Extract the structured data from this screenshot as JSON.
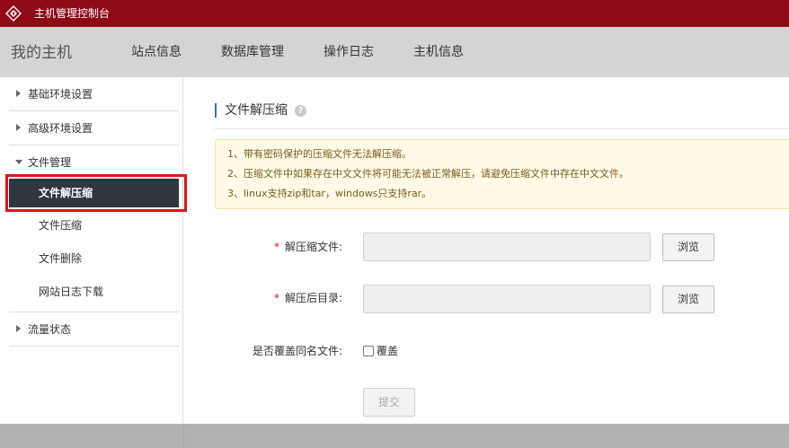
{
  "header": {
    "title": "主机管理控制台",
    "logo_icon": "diamond-logo-icon",
    "bg_color": "#8f0a16"
  },
  "nav": {
    "brand": "我的主机",
    "items": [
      {
        "label": "站点信息"
      },
      {
        "label": "数据库管理"
      },
      {
        "label": "操作日志"
      },
      {
        "label": "主机信息"
      }
    ]
  },
  "sidebar": {
    "groups": [
      {
        "label": "基础环境设置",
        "expanded": false
      },
      {
        "label": "高级环境设置",
        "expanded": false
      },
      {
        "label": "文件管理",
        "expanded": true,
        "items": [
          {
            "label": "文件解压缩",
            "active": true
          },
          {
            "label": "文件压缩",
            "active": false
          },
          {
            "label": "文件删除",
            "active": false
          },
          {
            "label": "网站日志下载",
            "active": false
          }
        ]
      },
      {
        "label": "流量状态",
        "expanded": false
      }
    ],
    "active_color": "#2f3640",
    "highlight_color": "#e3121b"
  },
  "main": {
    "title": "文件解压缩",
    "help_icon": "question-mark-icon",
    "notices": [
      "1、带有密码保护的压缩文件无法解压缩。",
      "2、压缩文件中如果存在中文文件将可能无法被正常解压，请避免压缩文件中存在中文文件。",
      "3、linux支持zip和tar，windows只支持rar。"
    ],
    "form": {
      "required_mark": "*",
      "archive_label": "解压缩文件:",
      "archive_value": "",
      "target_label": "解压后目录:",
      "target_value": "",
      "browse_label": "浏览",
      "overwrite_label": "是否覆盖同名文件:",
      "overwrite_checkbox_label": "覆盖",
      "overwrite_checked": false,
      "submit_label": "提交"
    }
  }
}
